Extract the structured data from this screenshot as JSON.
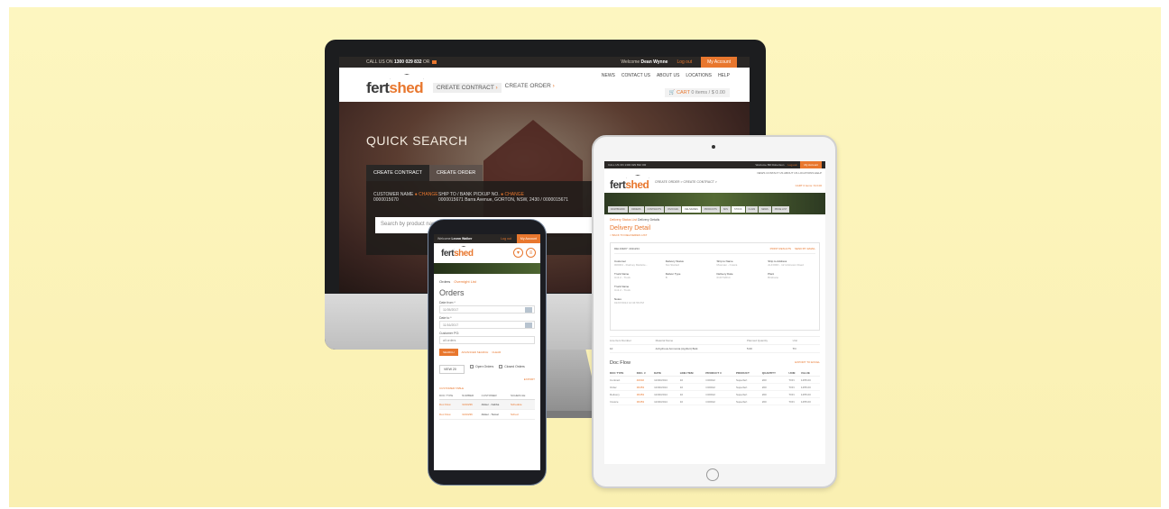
{
  "desktop": {
    "topbar": {
      "call_label": "CALL US ON",
      "phone": "1300 029 832",
      "or": "OR",
      "welcome_label": "Welcome",
      "user": "Dean Wynne",
      "logout": "Log out",
      "account": "My Account"
    },
    "logo_prefix": "fert",
    "logo_suffix": "shed",
    "nav": {
      "create_contract": "CREATE CONTRACT",
      "create_order": "CREATE ORDER"
    },
    "right_nav": [
      "NEWS",
      "CONTACT US",
      "ABOUT US",
      "LOCATIONS",
      "HELP"
    ],
    "cart": {
      "label": "CART",
      "value": "0 items / $ 0.00"
    },
    "hero": {
      "title": "QUICK SEARCH",
      "tabs": [
        "CREATE CONTRACT",
        "CREATE ORDER"
      ],
      "customer_label": "CUSTOMER NAME",
      "change": "CHANGE",
      "customer_value": "0000015670",
      "ship_label": "SHIP TO / BANK PICKUP NO.",
      "ship_value": "0000015671 Barra Avenue, GORTON, NSW, 2430 / 0000015671",
      "search_placeholder": "Search by product name"
    }
  },
  "tablet": {
    "topbar": {
      "call": "CALL US ON 1300 029 832 OR",
      "welcome": "Welcome Bill Robertson",
      "logout": "Log out",
      "account": "My Account"
    },
    "logo_prefix": "fert",
    "logo_suffix": "shed",
    "nav": "CREATE ORDER  >   CREATE CONTRACT  >",
    "right_nav": "NEWS  CONTACT US  ABOUT US  LOCATIONS  HELP",
    "cart": "CART  0 items / $ 0.00",
    "tabs": [
      "DASHBOARD",
      "ORDERS",
      "CONTRACTS",
      "INVOICES",
      "DELIVERIES",
      "PRODUCTS",
      "SDS",
      "STOCK",
      "CLAIM",
      "NEWS",
      "PRICE LIST"
    ],
    "crumb_link": "Delivery Status List",
    "crumb_current": "Delivery Details",
    "title": "Delivery Detail",
    "back": "< BACK TO DELIVERIES LIST",
    "card": {
      "header": "DELIVERY: 4011234",
      "actions": [
        "PRINT RESULTS",
        "SEND BY EMAIL"
      ],
      "fields": [
        {
          "label": "Customer",
          "value": "000001 - Rodney Marlette..."
        },
        {
          "label": "Delivery Status",
          "value": "Not Started"
        },
        {
          "label": "Ship to Name",
          "value": "Mosman - Cowra"
        },
        {
          "label": "Ship to Address",
          "value": "ALFORD - 12 Unknown Road"
        },
        {
          "label": "Truck Name",
          "value": "Unit 2 - Truck"
        },
        {
          "label": "Deliver Type",
          "value": "B"
        },
        {
          "label": "Delivery Date",
          "value": "01/07/2014"
        },
        {
          "label": "Plant",
          "value": "Brisbane"
        },
        {
          "label": "Truck Name",
          "value": "Unit 2 - Truck"
        },
        {
          "label": "",
          "value": ""
        },
        {
          "label": "",
          "value": ""
        },
        {
          "label": "",
          "value": ""
        },
        {
          "label": "Notes",
          "value": "01/07/2014 12:34:56 PM"
        }
      ]
    },
    "lines": {
      "headers": [
        "Line Item Number",
        "Material Name",
        "Planned Quantity",
        "Unit"
      ],
      "row": [
        "10",
        "Anhydrous Ammonia (Agrifert) Bulk",
        "5.00",
        "TO"
      ]
    },
    "doc_flow": {
      "title": "Doc Flow",
      "export": "EXPORT TO EXCEL",
      "headers": [
        "DOC TYPE",
        "DOC. #",
        "DATE",
        "LINE ITEM",
        "PRODUCT #",
        "PRODUCT",
        "QUANTITY",
        "UOM",
        "VALUE"
      ],
      "rows": [
        [
          "Contract",
          "40032",
          "11/30/2014",
          "10",
          "C00912",
          "Superfert",
          "200",
          "TON",
          "1255.00"
        ],
        [
          "Order",
          "30453",
          "11/30/2014",
          "10",
          "C00912",
          "Superfert",
          "200",
          "TON",
          "1255.00"
        ],
        [
          "Delivery",
          "30453",
          "11/30/2014",
          "10",
          "C00912",
          "Superfert",
          "200",
          "TON",
          "1255.00"
        ],
        [
          "Invoice",
          "30453",
          "11/30/2014",
          "10",
          "C00912",
          "Superfert",
          "200",
          "TON",
          "1255.00"
        ]
      ]
    }
  },
  "phone": {
    "topbar": {
      "welcome_label": "Welcome",
      "user": "Leonn Walker",
      "logout": "Log out",
      "account": "My Account"
    },
    "logo_prefix": "fert",
    "logo_suffix": "shed",
    "crumb": "Orders",
    "crumb_link": "Overnight List",
    "title": "Orders",
    "date_from_label": "Date from *",
    "date_from": "11/05/2017",
    "date_to_label": "Date to *",
    "date_to": "11/16/2017",
    "customer_po_label": "Customer PO:",
    "customer_po_placeholder": "all orders",
    "search": "SEARCH",
    "advanced": "ADVANCED SEARCH",
    "clear": "CLEAR",
    "view": "VIEW 20",
    "open_orders": "Open Orders",
    "closed_orders": "Closed Orders",
    "export": "EXPORT",
    "table_title": "CUSTOMER TABLE",
    "headers": [
      "DOC TYPE",
      "NUMBER",
      "CUSTOMER",
      "SCHEDULE"
    ],
    "rows": [
      [
        "Doc Flow",
        "3210236",
        "Alister - Kabba",
        "Schedule"
      ],
      [
        "Doc Flow",
        "3210236",
        "Alister - Tamal",
        "Sched"
      ]
    ],
    "colors": {
      "accent": "#e8772e"
    }
  }
}
